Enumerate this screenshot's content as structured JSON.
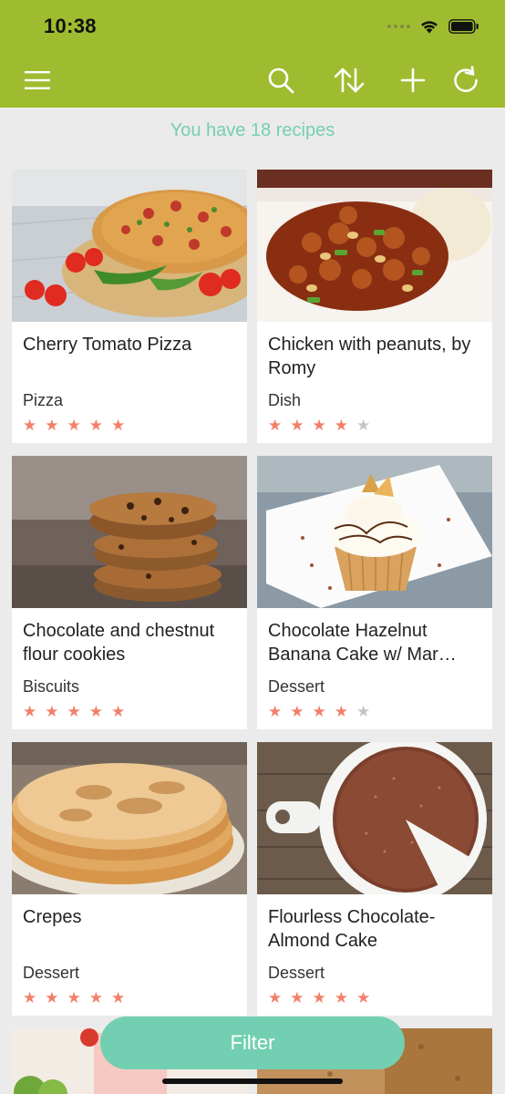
{
  "status": {
    "time": "10:38"
  },
  "header": {
    "icons": [
      "menu-icon",
      "search-icon",
      "sort-icon",
      "add-icon",
      "refresh-icon"
    ],
    "accent": "#9fbb2f"
  },
  "summary": {
    "count_text": "You have 18 recipes",
    "color": "#74cfaf"
  },
  "recipes": [
    {
      "title": "Cherry Tomato Pizza",
      "category": "Pizza",
      "rating": 5
    },
    {
      "title": "Chicken with peanuts, by Romy",
      "category": "Dish",
      "rating": 4
    },
    {
      "title": "Chocolate and chestnut flour cookies",
      "category": "Biscuits",
      "rating": 5
    },
    {
      "title": "Chocolate Hazelnut Banana Cake w/ Mar…",
      "category": "Dessert",
      "rating": 4
    },
    {
      "title": "Crepes",
      "category": "Dessert",
      "rating": 5
    },
    {
      "title": "Flourless Chocolate-Almond Cake",
      "category": "Dessert",
      "rating": 5
    }
  ],
  "filter": {
    "label": "Filter",
    "color": "#72cfb1"
  },
  "star_color": "#f2806a"
}
